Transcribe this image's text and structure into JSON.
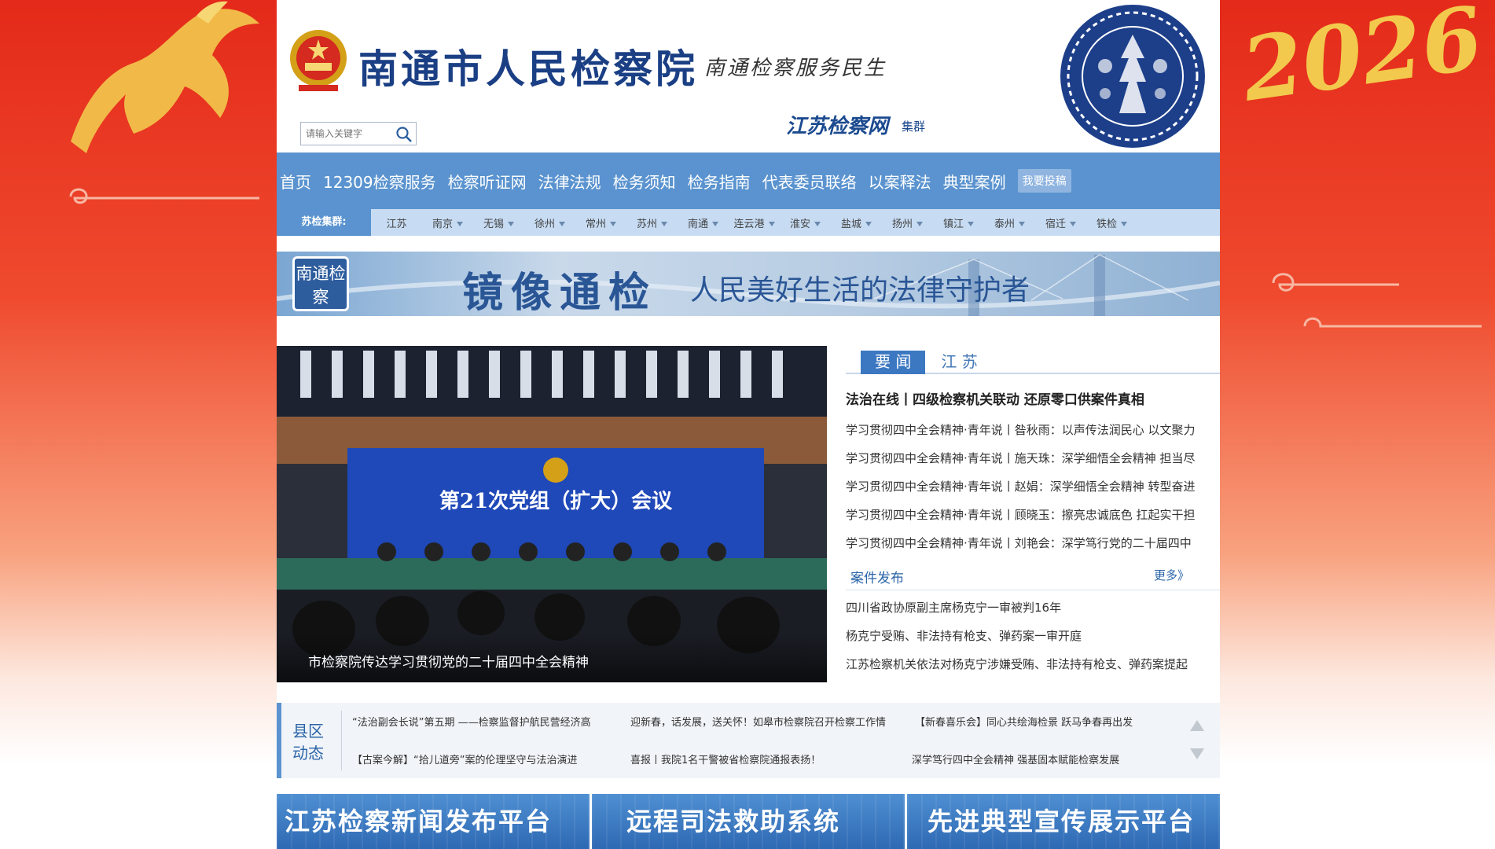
{
  "header": {
    "site_title": "南通市人民检察院",
    "slogan": "南通检察服务民生",
    "search_placeholder": "请输入关键字",
    "group_logo": "江苏检察网",
    "group_label": "集群"
  },
  "decor": {
    "year": "2026"
  },
  "main_nav": [
    {
      "label": "首页"
    },
    {
      "label": "12309检察服务"
    },
    {
      "label": "检察听证网"
    },
    {
      "label": "法律法规"
    },
    {
      "label": "检务须知"
    },
    {
      "label": "检务指南"
    },
    {
      "label": "代表委员联络"
    },
    {
      "label": "以案释法"
    },
    {
      "label": "典型案例"
    },
    {
      "label": "我要投稿"
    }
  ],
  "sub_nav": {
    "label": "苏检集群:",
    "cities": [
      "江苏",
      "南京",
      "无锡",
      "徐州",
      "常州",
      "苏州",
      "南通",
      "连云港",
      "淮安",
      "盐城",
      "扬州",
      "镇江",
      "泰州",
      "宿迁",
      "铁检"
    ]
  },
  "banner": {
    "badge": "南通检察",
    "title": "镜像通检",
    "subtitle": "人民美好生活的法律守护者"
  },
  "hero": {
    "caption": "市检察院传达学习贯彻党的二十届四中全会精神",
    "screen_text": "第21次党组（扩大）会议"
  },
  "news": {
    "tabs": [
      "要 闻",
      "江 苏"
    ],
    "headline": "法治在线丨四级检察机关联动 还原零口供案件真相",
    "items": [
      "学习贯彻四中全会精神·青年说丨昝秋雨：以声传法润民心 以文聚力",
      "学习贯彻四中全会精神·青年说丨施天珠：深学细悟全会精神 担当尽",
      "学习贯彻四中全会精神·青年说丨赵娟：深学细悟全会精神 转型奋进",
      "学习贯彻四中全会精神·青年说丨顾晓玉：擦亮忠诚底色 扛起实干担",
      "学习贯彻四中全会精神·青年说丨刘艳会：深学笃行党的二十届四中"
    ],
    "case_section_title": "案件发布",
    "more_label": "更多》",
    "cases": [
      "四川省政协原副主席杨克宁一审被判16年",
      "杨克宁受贿、非法持有枪支、弹药案一审开庭",
      "江苏检察机关依法对杨克宁涉嫌受贿、非法持有枪支、弹药案提起"
    ]
  },
  "county": {
    "label_line1": "县区",
    "label_line2": "动态",
    "items": [
      "“法治副会长说”第五期 ——检察监督护航民营经济高",
      "迎新春，话发展，送关怀！如皋市检察院召开检察工作情",
      "【新春喜乐会】同心共绘海检景 跃马争春再出发",
      "【古案今解】“拾儿道旁”案的伦理坚守与法治演进",
      "喜报丨我院1名干警被省检察院通报表扬！",
      "深学笃行四中全会精神 强基固本赋能检察发展"
    ]
  },
  "platforms": [
    "江苏检察新闻发布平台",
    "远程司法救助系统",
    "先进典型宣传展示平台"
  ],
  "colors": {
    "nav_blue": "#5a93cf",
    "subnav_blue": "#c7dcf3",
    "title_blue": "#1b3f84",
    "festive_red": "#e42a1a",
    "gold": "#f2c94c"
  }
}
